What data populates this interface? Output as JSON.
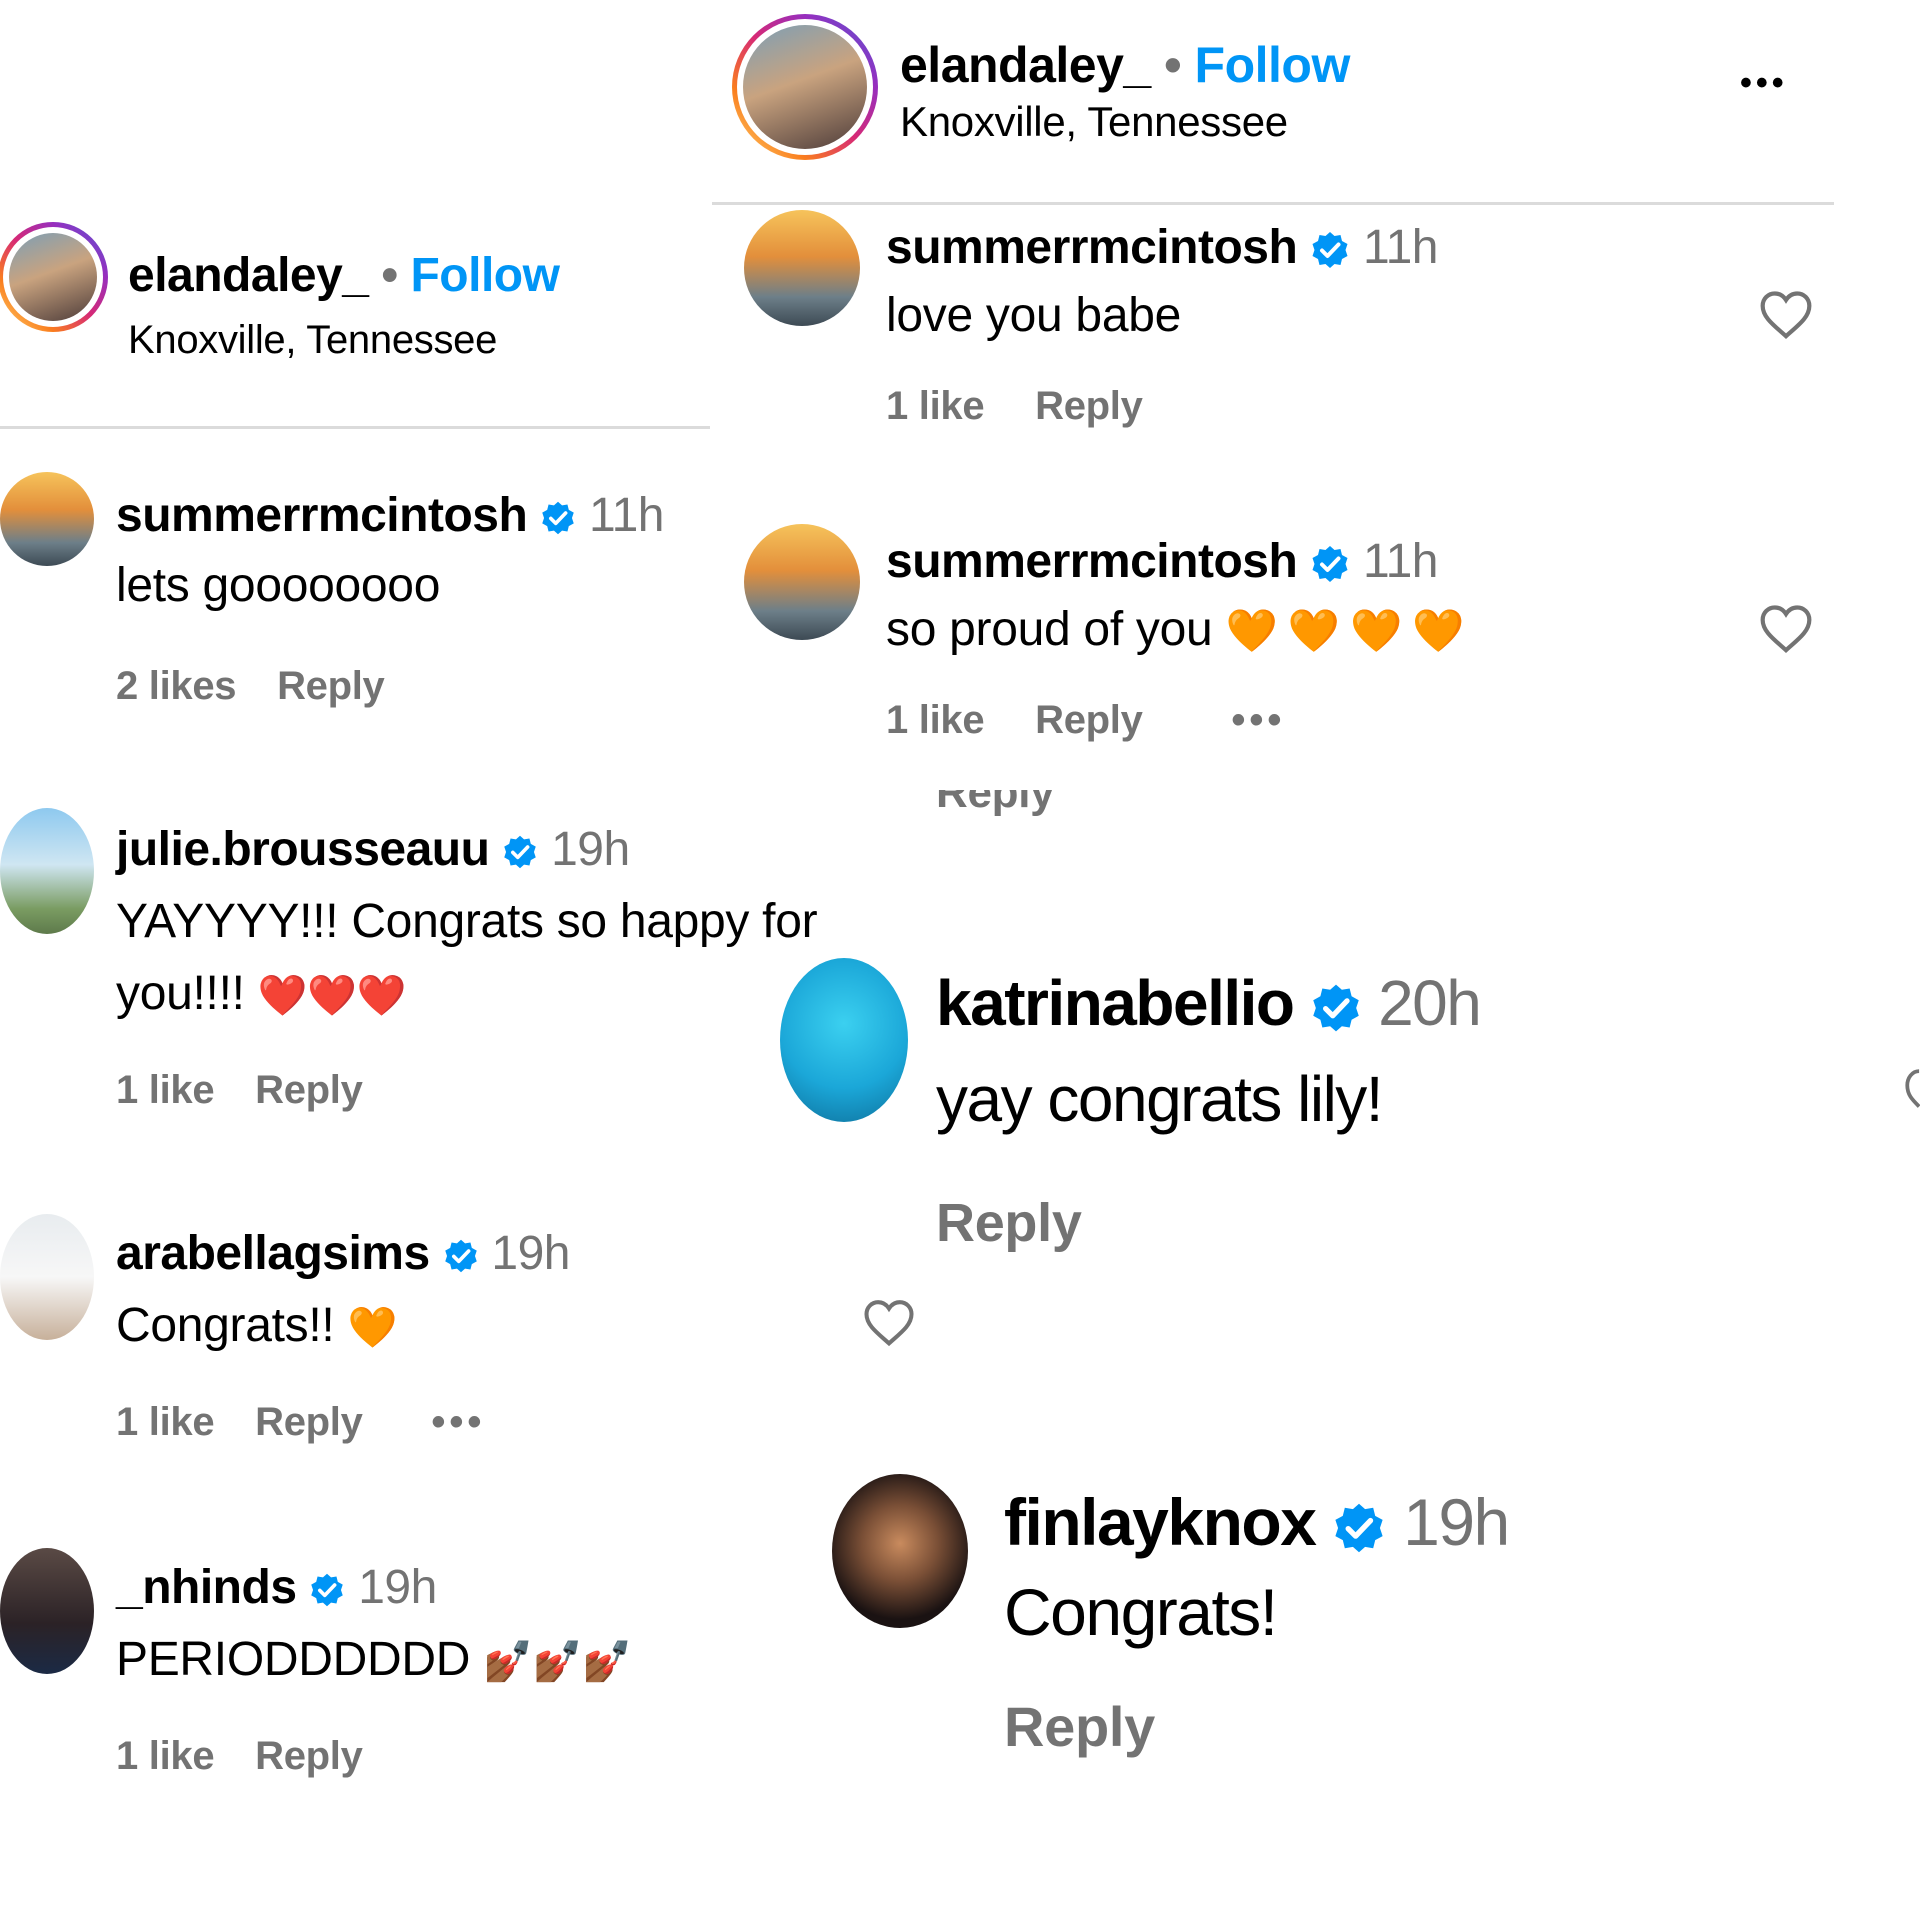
{
  "left_panel": {
    "header": {
      "username": "elandaley_",
      "separator": "•",
      "follow_label": "Follow",
      "location": "Knoxville, Tennessee"
    },
    "comments": [
      {
        "username": "summerrmcintosh",
        "time": "11h",
        "text": "lets goooooooo",
        "likes": "2 likes",
        "reply": "Reply"
      },
      {
        "username": "julie.brousseauu",
        "time": "19h",
        "text_line1": "YAYYYY!!! Congrats so happy for",
        "text_line2": "you!!!!",
        "emoji": "❤️❤️❤️",
        "likes": "1 like",
        "reply": "Reply"
      },
      {
        "username": "arabellagsims",
        "time": "19h",
        "text": "Congrats!!",
        "emoji": "🧡",
        "likes": "1 like",
        "reply": "Reply",
        "more": "•••"
      },
      {
        "username": "_nhinds",
        "time": "19h",
        "text": "PERIODDDDDD",
        "emoji": "💅🏾💅🏾💅🏾",
        "likes": "1 like",
        "reply": "Reply"
      }
    ]
  },
  "right_panel": {
    "header": {
      "username": "elandaley_",
      "separator": "•",
      "follow_label": "Follow",
      "location": "Knoxville, Tennessee",
      "more": "•••"
    },
    "comments": [
      {
        "username": "summerrmcintosh",
        "time": "11h",
        "text": "love you babe",
        "likes": "1 like",
        "reply": "Reply"
      },
      {
        "username": "summerrmcintosh",
        "time": "11h",
        "text": "so proud of you",
        "emoji": "🧡🧡🧡🧡",
        "likes": "1 like",
        "reply": "Reply",
        "more": "•••"
      }
    ],
    "cut_reply": "Reply",
    "large_comments": [
      {
        "username": "katrinabellio",
        "time": "20h",
        "text": "yay congrats lily!",
        "reply": "Reply"
      },
      {
        "username": "finlayknox",
        "time": "19h",
        "text": "Congrats!",
        "reply": "Reply"
      }
    ]
  },
  "colors": {
    "follow": "#0095f6",
    "verified": "#0095f6",
    "muted": "#737373"
  },
  "icons": [
    "verified-badge-icon",
    "heart-icon",
    "more-icon"
  ]
}
